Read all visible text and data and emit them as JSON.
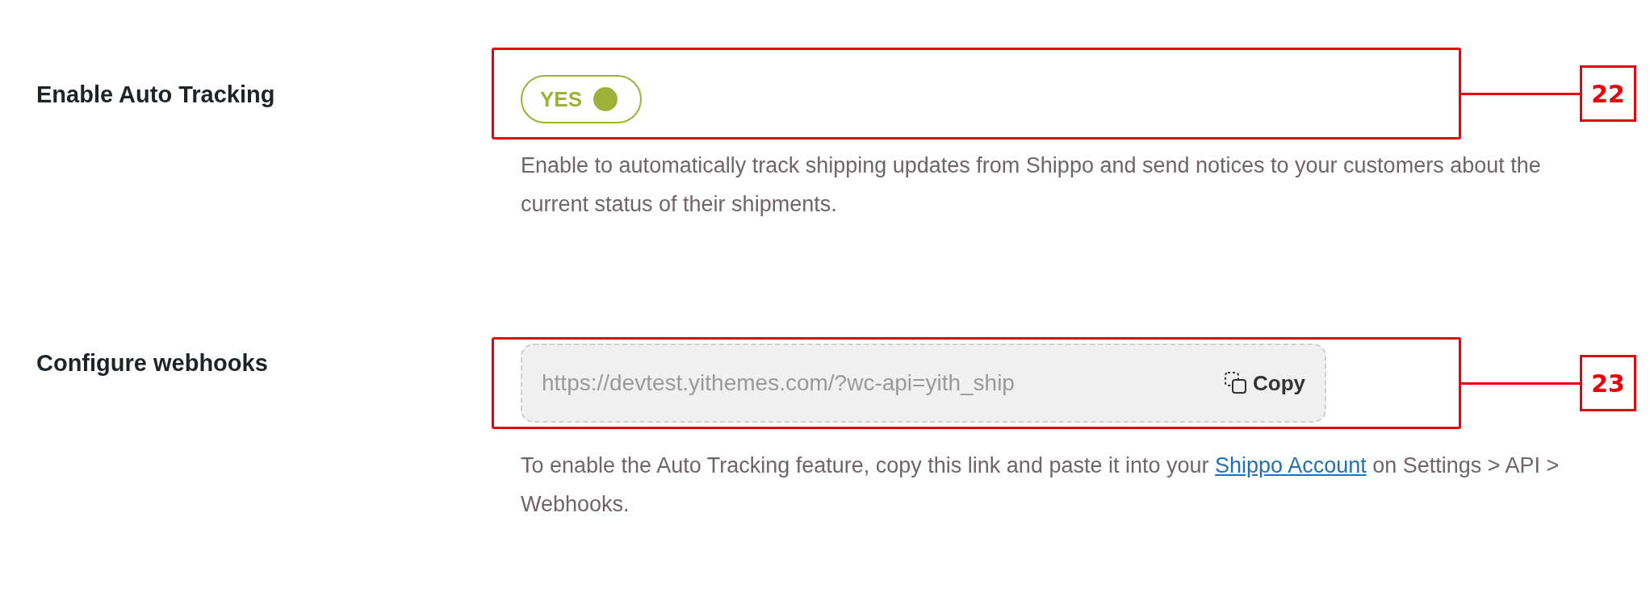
{
  "settings": [
    {
      "kind": "toggle",
      "label": "Enable Auto Tracking",
      "toggle": {
        "text": "YES",
        "on": true
      },
      "callout": "22",
      "description": {
        "text": "Enable to automatically track shipping updates from Shippo and send notices to your customers about the current status of their shipments."
      }
    },
    {
      "kind": "copy_field",
      "label": "Configure webhooks",
      "field": {
        "value": "https://devtest.yithemes.com/?wc-api=yith_ship",
        "button": "Copy"
      },
      "callout": "23",
      "description": {
        "text": "To enable the Auto Tracking feature, copy this link and paste it into your",
        "link": "Shippo Account",
        "text_after": "on Settings > API > Webhooks."
      }
    }
  ]
}
